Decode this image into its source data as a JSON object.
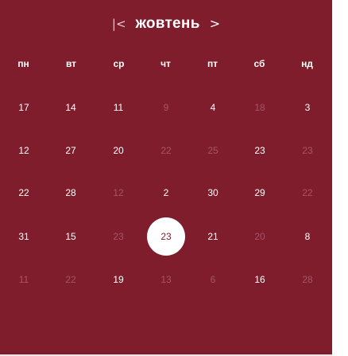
{
  "header": {
    "prev_icon": "|<",
    "month": "жовтень",
    "next_icon": ">"
  },
  "weekdays": [
    "пн",
    "вт",
    "ср",
    "чт",
    "пт",
    "сб",
    "нд"
  ],
  "weeks": [
    [
      {
        "label": "17",
        "muted": false
      },
      {
        "label": "14",
        "muted": false
      },
      {
        "label": "11",
        "muted": false
      },
      {
        "label": "9",
        "muted": true
      },
      {
        "label": "4",
        "muted": false
      },
      {
        "label": "18",
        "muted": true
      },
      {
        "label": "3",
        "muted": false
      }
    ],
    [
      {
        "label": "12",
        "muted": false
      },
      {
        "label": "27",
        "muted": false
      },
      {
        "label": "20",
        "muted": false
      },
      {
        "label": "22",
        "muted": true
      },
      {
        "label": "25",
        "muted": true
      },
      {
        "label": "23",
        "muted": false
      },
      {
        "label": "23",
        "muted": true
      }
    ],
    [
      {
        "label": "22",
        "muted": false
      },
      {
        "label": "28",
        "muted": false
      },
      {
        "label": "12",
        "muted": true
      },
      {
        "label": "2",
        "muted": false
      },
      {
        "label": "30",
        "muted": false
      },
      {
        "label": "29",
        "muted": false
      },
      {
        "label": "22",
        "muted": true
      }
    ],
    [
      {
        "label": "31",
        "muted": false
      },
      {
        "label": "15",
        "muted": false
      },
      {
        "label": "23",
        "muted": true
      },
      {
        "label": "23",
        "muted": false,
        "selected": true
      },
      {
        "label": "21",
        "muted": false
      },
      {
        "label": "20",
        "muted": true
      },
      {
        "label": "8",
        "muted": false
      }
    ],
    [
      {
        "label": "11",
        "muted": true
      },
      {
        "label": "22",
        "muted": true
      },
      {
        "label": "19",
        "muted": false
      },
      {
        "label": "13",
        "muted": true
      },
      {
        "label": "6",
        "muted": true
      },
      {
        "label": "16",
        "muted": false
      },
      {
        "label": "28",
        "muted": true
      }
    ]
  ],
  "colors": {
    "background": "#7f1d2d",
    "text": "#ffffff",
    "muted_text": "#a45566",
    "selected_background": "#ffffff",
    "selected_text": "#7f1d2d"
  }
}
